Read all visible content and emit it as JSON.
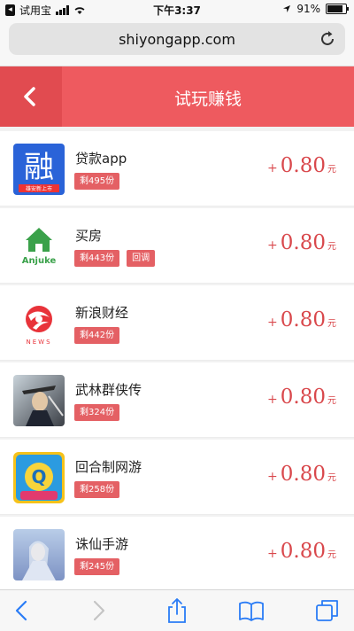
{
  "status_bar": {
    "back_app": "试用宝",
    "time": "下午3:37",
    "battery": "91%"
  },
  "browser": {
    "url": "shiyongapp.com"
  },
  "header": {
    "title": "试玩赚钱"
  },
  "apps": [
    {
      "name": "贷款app",
      "badges": [
        "剩495份"
      ],
      "plus": "+",
      "amount": "0.80",
      "unit": "元",
      "icon": "rong-icon",
      "icon_text": "融",
      "icon_subtext": "雄安新上市"
    },
    {
      "name": "买房",
      "badges": [
        "剩443份",
        "回调"
      ],
      "plus": "+",
      "amount": "0.80",
      "unit": "元",
      "icon": "anjuke-icon",
      "icon_text": "Anjuke"
    },
    {
      "name": "新浪财经",
      "badges": [
        "剩442份"
      ],
      "plus": "+",
      "amount": "0.80",
      "unit": "元",
      "icon": "sina-icon",
      "icon_text": "NEWS"
    },
    {
      "name": "武林群侠传",
      "badges": [
        "剩324份"
      ],
      "plus": "+",
      "amount": "0.80",
      "unit": "元",
      "icon": "wulin-game-icon"
    },
    {
      "name": "回合制网游",
      "badges": [
        "剩258份"
      ],
      "plus": "+",
      "amount": "0.80",
      "unit": "元",
      "icon": "turn-based-game-icon",
      "icon_text": "Q"
    },
    {
      "name": "诛仙手游",
      "badges": [
        "剩245份"
      ],
      "plus": "+",
      "amount": "0.80",
      "unit": "元",
      "icon": "zhuxian-game-icon"
    }
  ],
  "toolbar": {
    "items": [
      "back-icon",
      "forward-icon",
      "share-icon",
      "bookmarks-icon",
      "tabs-icon"
    ]
  }
}
